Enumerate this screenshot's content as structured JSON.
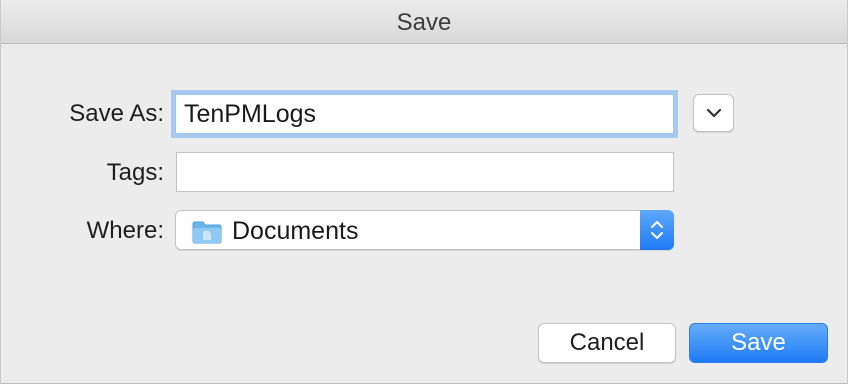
{
  "window": {
    "title": "Save"
  },
  "form": {
    "save_as_label": "Save As:",
    "save_as_value": "TenPMLogs",
    "tags_label": "Tags:",
    "tags_value": "",
    "where_label": "Where:",
    "where_value": "Documents",
    "where_icon": "folder-icon"
  },
  "buttons": {
    "cancel_label": "Cancel",
    "save_label": "Save"
  },
  "colors": {
    "accent": "#1e7bf5",
    "focus_ring": "#a9c9f1",
    "background": "#ececec"
  }
}
